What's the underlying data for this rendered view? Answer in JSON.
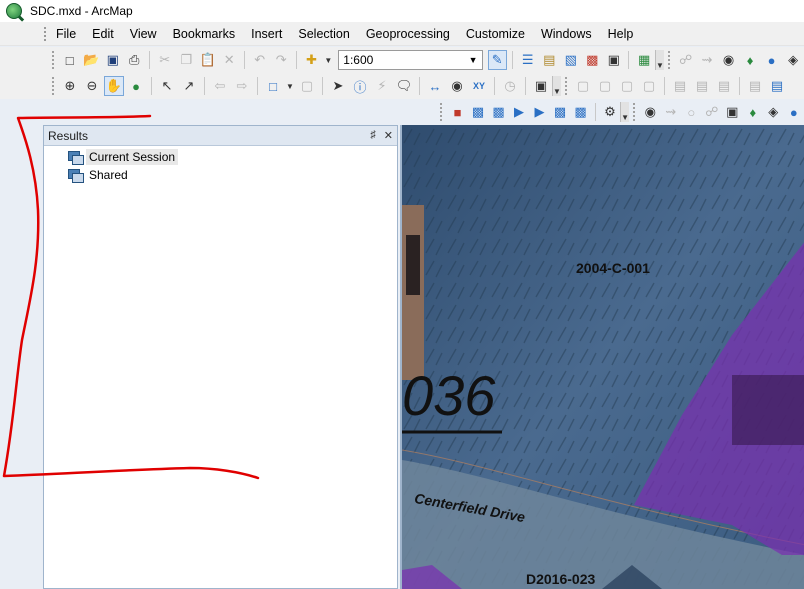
{
  "window": {
    "title": "SDC.mxd - ArcMap"
  },
  "menu": [
    "File",
    "Edit",
    "View",
    "Bookmarks",
    "Insert",
    "Selection",
    "Geoprocessing",
    "Customize",
    "Windows",
    "Help"
  ],
  "toolbar": {
    "scale": "1:600"
  },
  "results_panel": {
    "title": "Results",
    "items": [
      {
        "label": "Current Session",
        "selected": true
      },
      {
        "label": "Shared",
        "selected": false
      }
    ]
  },
  "map": {
    "labels": {
      "parcel_1": "2004-C-001",
      "parcel_number": "036",
      "street": "Centerfield Drive",
      "parcel_2": "D2016-023"
    },
    "colors": {
      "imagery_tint": "#3e5f82",
      "parcel_fill": "#7a2fb0",
      "annotation": "#e00000"
    }
  }
}
